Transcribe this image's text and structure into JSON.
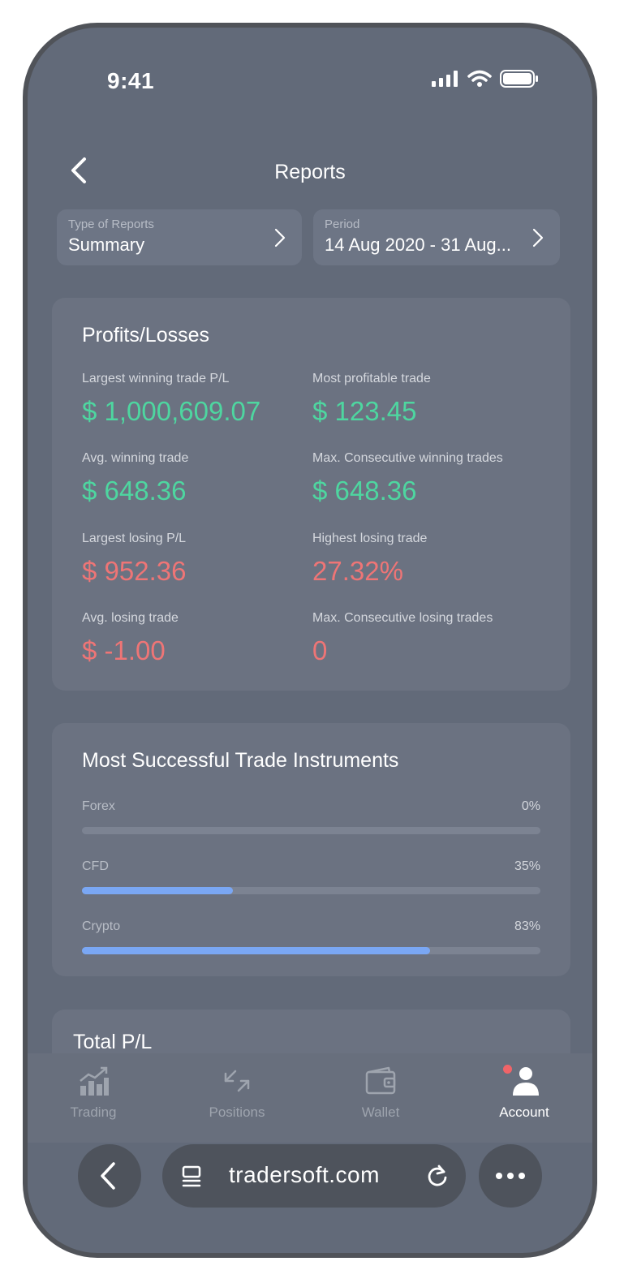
{
  "status_bar": {
    "time": "9:41"
  },
  "header": {
    "title": "Reports"
  },
  "filters": {
    "type": {
      "label": "Type of Reports",
      "value": "Summary"
    },
    "period": {
      "label": "Period",
      "value": "14 Aug 2020 - 31 Aug..."
    }
  },
  "profits_losses": {
    "title": "Profits/Losses",
    "metrics": [
      {
        "label": "Largest winning trade P/L",
        "value": "$ 1,000,609.07",
        "tone": "positive"
      },
      {
        "label": "Most profitable trade",
        "value": "$ 123.45",
        "tone": "positive"
      },
      {
        "label": "Avg. winning trade",
        "value": "$ 648.36",
        "tone": "positive"
      },
      {
        "label": "Max. Consecutive winning trades",
        "value": "$ 648.36",
        "tone": "positive"
      },
      {
        "label": "Largest losing P/L",
        "value": "$ 952.36",
        "tone": "negative"
      },
      {
        "label": "Highest losing trade",
        "value": "27.32%",
        "tone": "negative"
      },
      {
        "label": "Avg. losing trade",
        "value": "$ -1.00",
        "tone": "negative"
      },
      {
        "label": "Max. Consecutive losing trades",
        "value": "0",
        "tone": "negative"
      }
    ]
  },
  "instruments": {
    "title": "Most Successful Trade Instruments",
    "items": [
      {
        "label": "Forex",
        "percent_text": "0%",
        "fraction": 0.0
      },
      {
        "label": "CFD",
        "percent_text": "35%",
        "fraction": 0.33
      },
      {
        "label": "Crypto",
        "percent_text": "83%",
        "fraction": 0.76
      }
    ]
  },
  "total_pl": {
    "title": "Total P/L"
  },
  "tabbar": {
    "items": [
      {
        "label": "Trading",
        "icon": "trading-chart-icon"
      },
      {
        "label": "Positions",
        "icon": "arrows-swap-icon"
      },
      {
        "label": "Wallet",
        "icon": "wallet-icon"
      },
      {
        "label": "Account",
        "icon": "account-icon",
        "active": true,
        "has_notification": true
      }
    ]
  },
  "browser": {
    "url": "tradersoft.com"
  },
  "colors": {
    "positive": "#4ed6a0",
    "negative": "#ee7576",
    "bar_fill": "#7aa7f4",
    "notification": "#f06468"
  }
}
